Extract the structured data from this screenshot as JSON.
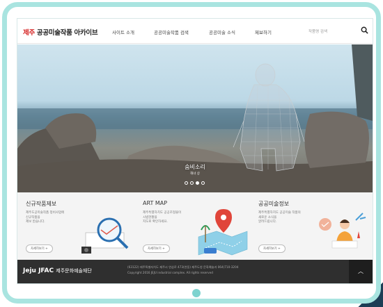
{
  "header": {
    "logo_text": "제주 공공미술작품 아카이브",
    "nav": [
      "사이트 소개",
      "공공미술작품 검색",
      "공공미술 소식",
      "제보하기"
    ],
    "search_placeholder": "작품명 검색"
  },
  "hero": {
    "caption_title": "숨비소리",
    "caption_sub": "해녀 상",
    "slide_count": 4,
    "active_slide": 3
  },
  "cards": [
    {
      "title": "신규작품제보",
      "desc": [
        "제주도공미술작품 정비사업에",
        "신규작품을",
        "제보 받습니다."
      ],
      "button": "자세히보기 +"
    },
    {
      "title": "ART MAP",
      "desc": [
        "제주특별자치도 공공조형물이",
        "시범현황을",
        "지도로 확인하세요."
      ],
      "button": "자세히보기 +"
    },
    {
      "title": "공공미술정보",
      "desc": [
        "제주특별자치도 공공미술 작품의",
        "새로운 소식을",
        "알려드립니다."
      ],
      "button": "자세히보기 +"
    }
  ],
  "footer": {
    "logo": "Jeju JFAC",
    "logo_sub": "제주문화예술재단",
    "info_line1": "(63122) 제주특별자치도 제주시 연삼로 473(연동) 제주도청 문화예술과 064)710-3204",
    "info_line2": "Copyright 2016 JEJU industrial complex. All rights reserved",
    "top_button": "︿"
  },
  "colors": {
    "frame": "#a9e4e0",
    "page_dot": "#7dd3cf",
    "footer_bg": "#2f2f2f",
    "logo_accent": "#d62828"
  }
}
